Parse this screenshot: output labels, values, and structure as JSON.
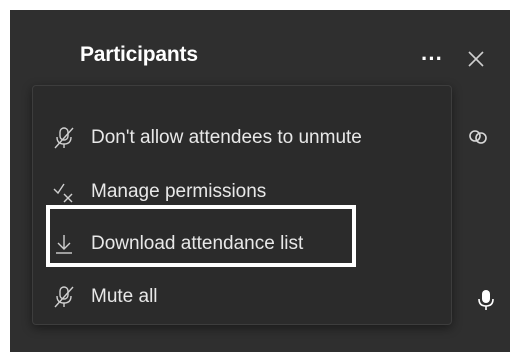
{
  "header": {
    "title": "Participants",
    "more_label": "···"
  },
  "menu": {
    "items": [
      {
        "label": "Don't allow attendees to unmute",
        "icon": "mic-off-icon"
      },
      {
        "label": "Manage permissions",
        "icon": "check-x-icon"
      },
      {
        "label": "Download attendance list",
        "icon": "download-icon"
      },
      {
        "label": "Mute all",
        "icon": "mic-off-icon"
      }
    ]
  },
  "side_icons": [
    "link-icon",
    "microphone-icon"
  ],
  "colors": {
    "panel_bg": "#2f2f2f",
    "menu_bg": "#2b2b2b",
    "text": "#e8e8e8",
    "highlight_border": "#ffffff"
  }
}
